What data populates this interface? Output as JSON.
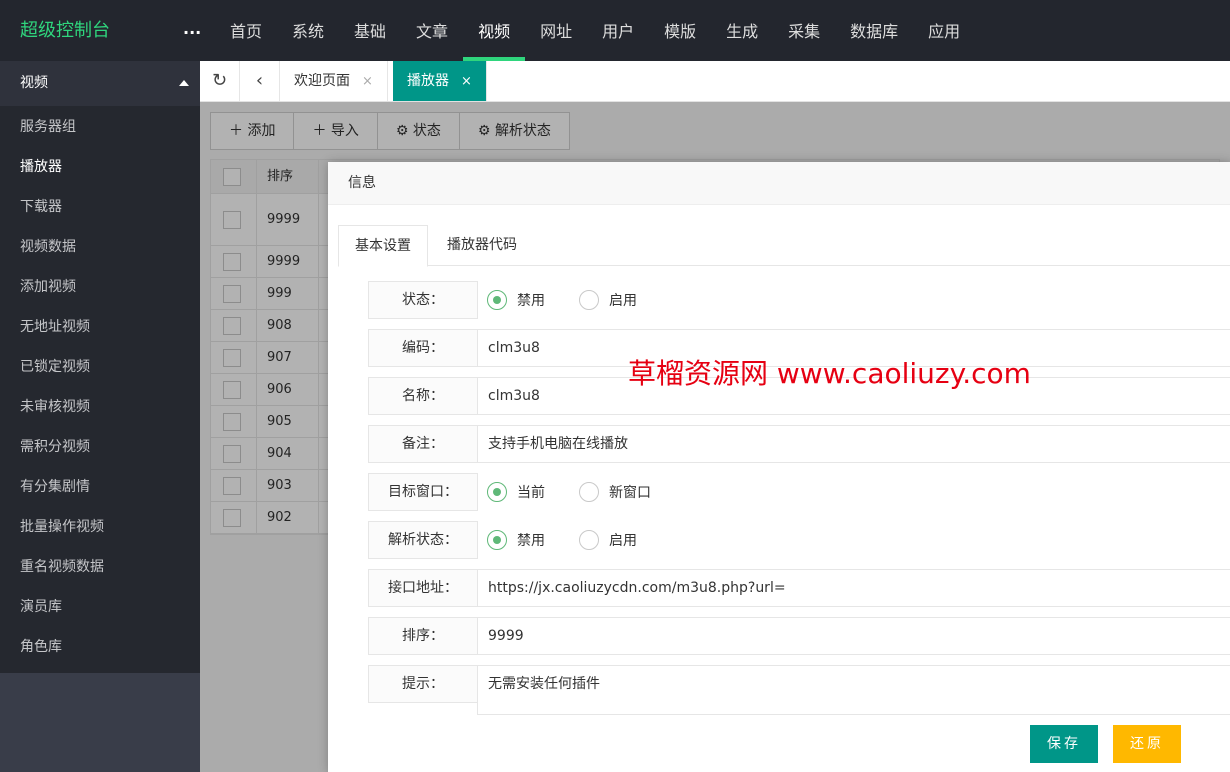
{
  "header": {
    "brand": "超级控制台",
    "more": "...",
    "nav": [
      "首页",
      "系统",
      "基础",
      "文章",
      "视频",
      "网址",
      "用户",
      "模版",
      "生成",
      "采集",
      "数据库",
      "应用"
    ],
    "active_index": 4
  },
  "sidebar": {
    "group": "视频",
    "items": [
      "服务器组",
      "播放器",
      "下载器",
      "视频数据",
      "添加视频",
      "无地址视频",
      "已锁定视频",
      "未审核视频",
      "需积分视频",
      "有分集剧情",
      "批量操作视频",
      "重名视频数据",
      "演员库",
      "角色库"
    ],
    "active_index": 1
  },
  "tabs": {
    "welcome": "欢迎页面",
    "player": "播放器",
    "close": "×"
  },
  "toolbar": {
    "add": "添加",
    "import": "导入",
    "status": "状态",
    "parse_status": "解析状态"
  },
  "table": {
    "col_sort": "排序",
    "rows": [
      "9999",
      "9999",
      "999",
      "908",
      "907",
      "906",
      "905",
      "904",
      "903",
      "902"
    ]
  },
  "modal": {
    "title": "信息",
    "tab_basic": "基本设置",
    "tab_code": "播放器代码",
    "fields": {
      "status_label": "状态：",
      "status_opt1": "禁用",
      "status_opt2": "启用",
      "code_label": "编码：",
      "code_value": "clm3u8",
      "name_label": "名称：",
      "name_value": "clm3u8",
      "note_label": "备注：",
      "note_value": "支持手机电脑在线播放",
      "target_label": "目标窗口：",
      "target_opt1": "当前",
      "target_opt2": "新窗口",
      "parse_label": "解析状态：",
      "parse_opt1": "禁用",
      "parse_opt2": "启用",
      "api_label": "接口地址：",
      "api_value": "https://jx.caoliuzycdn.com/m3u8.php?url=",
      "sort_label": "排序：",
      "sort_value": "9999",
      "tip_label": "提示：",
      "tip_value": "无需安装任何插件"
    },
    "save": "保存",
    "reset": "还原"
  },
  "watermark": "草榴资源网  www.caoliuzy.com",
  "colors": {
    "header_bg": "#23262e",
    "brand": "#2fd57d",
    "sidebar_bg": "#393d49",
    "tab_active": "#009688",
    "save_btn": "#009688",
    "reset_btn": "#ffb800",
    "radio_on": "#5fb878",
    "watermark": "#e60012"
  }
}
